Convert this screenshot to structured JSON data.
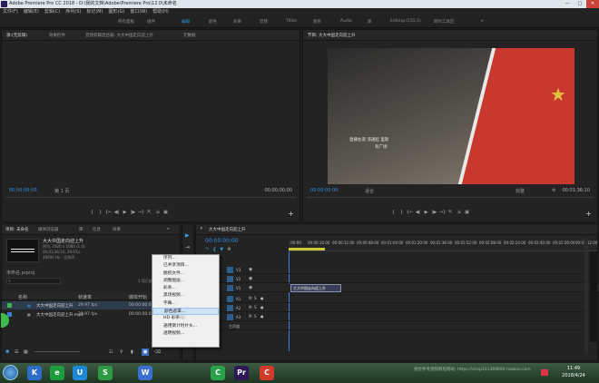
{
  "titlebar": {
    "title": "Adobe Premiere Pro CC 2018 - D:\\我的文档\\Adobe\\Premiere Pro\\12.0\\未命名"
  },
  "menubar": {
    "items": [
      "文件(F)",
      "编辑(E)",
      "剪辑(C)",
      "序列(S)",
      "标记(M)",
      "图形(G)",
      "窗口(W)",
      "帮助(H)"
    ]
  },
  "workspaces": {
    "items": [
      "所有面板",
      "组件",
      "编辑",
      "颜色",
      "效果",
      "音频",
      "Titles",
      "图形",
      "Audio",
      "库",
      "Editing (CS5.5)",
      "跨时工具区"
    ],
    "active": "编辑",
    "more": "»"
  },
  "source": {
    "tabs": [
      "源:(无剪辑)",
      "效果控件",
      "音频剪辑混合器: 大大中国走向迎上升",
      "元数据"
    ],
    "timecode_left": "00;00;00;00",
    "page": "第 1 页",
    "timecode_right": "00;00;00;00"
  },
  "program": {
    "tab": "节目: 大大中国走向迎上升",
    "subtitle_line1": "直播右道  流通起 里斯",
    "subtitle_line2": "有广场",
    "timecode_left": "00:00:00:00",
    "fit": "适合",
    "full": "完整",
    "timecode_right": "00:01:36:10"
  },
  "project": {
    "tabs": [
      "项目: 未命名",
      "媒体浏览器",
      "库",
      "信息",
      "效果"
    ],
    "clip_name": "大大中国走向迎上升",
    "clip_meta1": "序列, 1920 x 1080 (1.0)",
    "clip_meta2": "00;01;36;10, 29.97p",
    "clip_meta3": "48000 Hz - 立体声",
    "project_file": "未命名.prproj",
    "search_placeholder": "",
    "count": "1 项已选择",
    "columns": {
      "name": "名称",
      "fps": "帧速率",
      "start": "媒体开始"
    },
    "items": [
      {
        "name": "大大中国走向迎上升",
        "fps": "29.97 fps",
        "start": "00:00:00:00"
      },
      {
        "name": "大大中国走向迎上升.mp4",
        "fps": "29.97 fps",
        "start": "00:00:00:00"
      }
    ]
  },
  "timeline": {
    "tab": "大大中国走向迎上升",
    "timecode": "00:00:00:00",
    "ruler": [
      ":00:00",
      "00:00:16:00",
      "00:00:32:00",
      "00:00:48:00",
      "00:01:04:00",
      "00:01:20:00",
      "00:01:36:00",
      "00:01:52:00",
      "00:02:08:00",
      "00:02:24:00",
      "00:02:40:00",
      "00:02:56:00",
      "00:03:12:00"
    ],
    "tracks_v": [
      "V3",
      "V2",
      "V1"
    ],
    "tracks_a": [
      "A1",
      "A2",
      "A3"
    ],
    "master": "主声道",
    "clip_label": "大大中国走向迎上升"
  },
  "context_menu": {
    "items": [
      "序列...",
      "已共享项目...",
      "脱机文件...",
      "调整图层...",
      "彩条...",
      "黑场视频...",
      "字幕...",
      "颜色遮罩...",
      "HD 彩条...",
      "通用倒计时片头...",
      "透明视频..."
    ],
    "selected_index": 7
  },
  "taskbar": {
    "clock_time": "11:49",
    "clock_date": "2018/4/24",
    "watermark": "视觉参考视频教程网站: https://shop101369894.taobao.com",
    "apps": [
      "K",
      "e",
      "U",
      "S",
      "W",
      "C",
      "Pr",
      "C"
    ],
    "app_colors": [
      "#2b6ec8",
      "#1d9c3e",
      "#1e88d8",
      "#2d9b44",
      "#3b6fd0",
      "#2aa14a",
      "#2e1856",
      "#d23a2a"
    ]
  }
}
